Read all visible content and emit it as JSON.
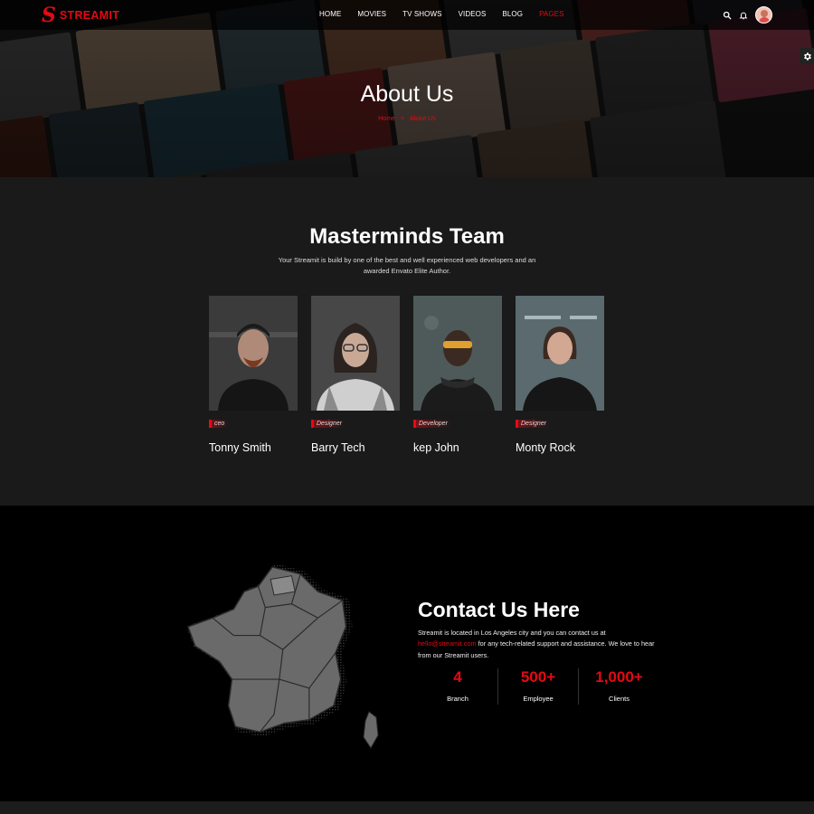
{
  "brand": {
    "logo_letter": "S",
    "name": "STREAMIT"
  },
  "nav": {
    "items": [
      {
        "label": "HOME"
      },
      {
        "label": "MOVIES"
      },
      {
        "label": "TV SHOWS"
      },
      {
        "label": "VIDEOS"
      },
      {
        "label": "BLOG"
      },
      {
        "label": "PAGES",
        "active": true
      }
    ]
  },
  "header_icons": [
    "search-icon",
    "bell-icon",
    "user-avatar"
  ],
  "hero": {
    "title": "About Us",
    "breadcrumb": {
      "home": "Home",
      "separator": ">",
      "current": "About Us"
    }
  },
  "team": {
    "title": "Masterminds Team",
    "description": "Your Streamit is build by one of the best and well experienced web developers and an awarded Envato Elite Author.",
    "members": [
      {
        "role": "ceo",
        "name": "Tonny Smith"
      },
      {
        "role": "Designer",
        "name": "Barry Tech"
      },
      {
        "role": "Developer",
        "name": "kep John"
      },
      {
        "role": "Designer",
        "name": "Monty Rock"
      }
    ]
  },
  "contact": {
    "title": "Contact Us Here",
    "text_before": "Streamit is located in Los Angeles city and you can contact us at ",
    "email": "hello@streamit.com",
    "text_after": " for any tech-related support and assistance. We love to hear from our Streamit users.",
    "stats": [
      {
        "value": "4",
        "label": "Branch"
      },
      {
        "value": "500+",
        "label": "Employee"
      },
      {
        "value": "1,000+",
        "label": "Clients"
      }
    ]
  },
  "colors": {
    "accent": "#e50914",
    "background": "#000000",
    "section": "#1a1a1a"
  }
}
